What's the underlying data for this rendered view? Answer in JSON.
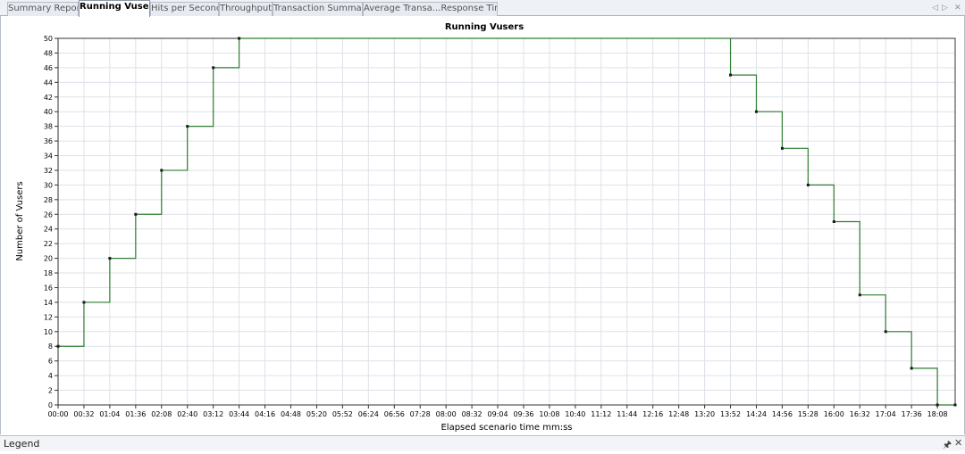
{
  "tabs": [
    {
      "label": "Summary Report",
      "active": false
    },
    {
      "label": "Running Vusers",
      "active": true
    },
    {
      "label": "Hits per Second",
      "active": false
    },
    {
      "label": "Throughput",
      "active": false
    },
    {
      "label": "Transaction Summary",
      "active": false
    },
    {
      "label": "Average Transa...Response Time",
      "active": false
    }
  ],
  "tab_nav": {
    "prev_icon": "◁",
    "next_icon": "▷",
    "close_icon": "✕"
  },
  "legend_panel": {
    "title": "Legend",
    "pin_icon": "🖈",
    "close_icon": "✕"
  },
  "colors": {
    "series": "#2e7d32",
    "marker": "#1a1a1a",
    "grid": "#dde1e8",
    "axis": "#333333"
  },
  "chart_data": {
    "type": "line",
    "step": true,
    "title": "Running Vusers",
    "xlabel": "Elapsed scenario time mm:ss",
    "ylabel": "Number of Vusers",
    "xlim": [
      0,
      1110
    ],
    "ylim": [
      0,
      50
    ],
    "y_ticks": [
      0,
      2,
      4,
      6,
      8,
      10,
      12,
      14,
      16,
      18,
      20,
      22,
      24,
      26,
      28,
      30,
      32,
      34,
      36,
      38,
      40,
      42,
      44,
      46,
      48,
      50
    ],
    "x_ticks": [
      "00:00",
      "00:32",
      "01:04",
      "01:36",
      "02:08",
      "02:40",
      "03:12",
      "03:44",
      "04:16",
      "04:48",
      "05:20",
      "05:52",
      "06:24",
      "06:56",
      "07:28",
      "08:00",
      "08:32",
      "09:04",
      "09:36",
      "10:08",
      "10:40",
      "11:12",
      "11:44",
      "12:16",
      "12:48",
      "13:20",
      "13:52",
      "14:24",
      "14:56",
      "15:28",
      "16:00",
      "16:32",
      "17:04",
      "17:36",
      "18:08"
    ],
    "x_tick_seconds": [
      0,
      32,
      64,
      96,
      128,
      160,
      192,
      224,
      256,
      288,
      320,
      352,
      384,
      416,
      448,
      480,
      512,
      544,
      576,
      608,
      640,
      672,
      704,
      736,
      768,
      800,
      832,
      864,
      896,
      928,
      960,
      992,
      1024,
      1056,
      1088
    ],
    "grid": true,
    "series": [
      {
        "points": [
          {
            "x": "00:00",
            "x_seconds": 0,
            "y": 8
          },
          {
            "x": "00:32",
            "x_seconds": 32,
            "y": 14
          },
          {
            "x": "01:04",
            "x_seconds": 64,
            "y": 20
          },
          {
            "x": "01:36",
            "x_seconds": 96,
            "y": 26
          },
          {
            "x": "02:08",
            "x_seconds": 128,
            "y": 32
          },
          {
            "x": "02:40",
            "x_seconds": 160,
            "y": 38
          },
          {
            "x": "03:12",
            "x_seconds": 192,
            "y": 46
          },
          {
            "x": "03:44",
            "x_seconds": 224,
            "y": 50
          },
          {
            "x": "13:52",
            "x_seconds": 832,
            "y": 45
          },
          {
            "x": "14:24",
            "x_seconds": 864,
            "y": 40
          },
          {
            "x": "14:56",
            "x_seconds": 896,
            "y": 35
          },
          {
            "x": "15:28",
            "x_seconds": 928,
            "y": 30
          },
          {
            "x": "16:00",
            "x_seconds": 960,
            "y": 25
          },
          {
            "x": "16:32",
            "x_seconds": 992,
            "y": 15
          },
          {
            "x": "17:04",
            "x_seconds": 1024,
            "y": 10
          },
          {
            "x": "17:36",
            "x_seconds": 1056,
            "y": 5
          },
          {
            "x": "18:08",
            "x_seconds": 1088,
            "y": 0
          },
          {
            "x": "18:30",
            "x_seconds": 1110,
            "y": 0
          }
        ]
      }
    ]
  }
}
